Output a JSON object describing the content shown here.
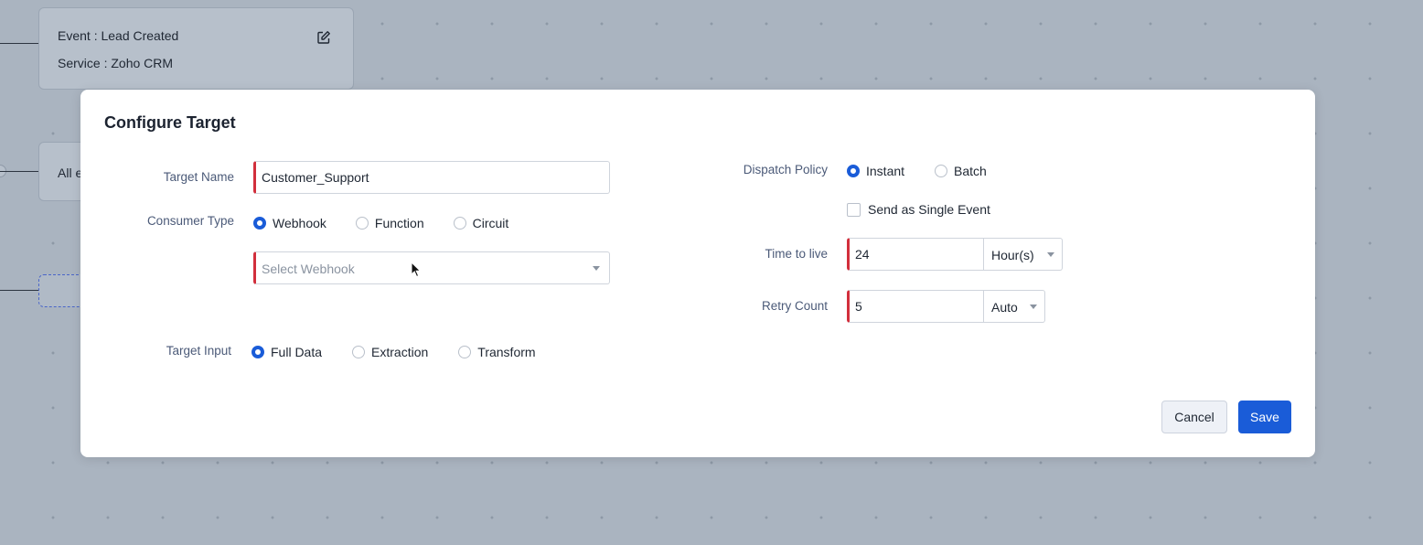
{
  "canvas": {
    "event_node": {
      "event_line": "Event : Lead Created",
      "service_line": "Service : Zoho CRM"
    },
    "all_node_text": "All e"
  },
  "modal": {
    "title": "Configure Target",
    "target_name": {
      "label": "Target Name",
      "value": "Customer_Support"
    },
    "consumer_type": {
      "label": "Consumer Type",
      "options": [
        "Webhook",
        "Function",
        "Circuit"
      ],
      "selected": "Webhook"
    },
    "webhook_select": {
      "placeholder": "Select Webhook"
    },
    "target_input": {
      "label": "Target Input",
      "options": [
        "Full Data",
        "Extraction",
        "Transform"
      ],
      "selected": "Full Data"
    },
    "dispatch_policy": {
      "label": "Dispatch Policy",
      "options": [
        "Instant",
        "Batch"
      ],
      "selected": "Instant"
    },
    "single_event": {
      "label": "Send as Single Event",
      "checked": false
    },
    "time_to_live": {
      "label": "Time to live",
      "value": "24",
      "unit": "Hour(s)"
    },
    "retry_count": {
      "label": "Retry Count",
      "value": "5",
      "mode": "Auto"
    },
    "buttons": {
      "cancel": "Cancel",
      "save": "Save"
    }
  },
  "colors": {
    "primary": "#1a5cd8",
    "required_marker": "#d22f3c",
    "label_text": "#4b5a78"
  }
}
